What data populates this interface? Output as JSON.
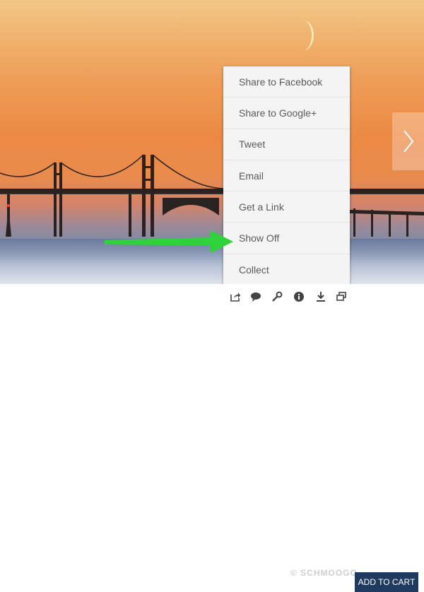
{
  "share_menu": {
    "items": [
      {
        "label": "Share to Facebook"
      },
      {
        "label": "Share to Google+"
      },
      {
        "label": "Tweet"
      },
      {
        "label": "Email"
      },
      {
        "label": "Get a Link"
      },
      {
        "label": "Show Off"
      },
      {
        "label": "Collect"
      }
    ]
  },
  "toolbar": {
    "icons": [
      "share-icon",
      "comment-icon",
      "wrench-icon",
      "info-icon",
      "download-icon",
      "slideshow-icon"
    ],
    "watermark": "© SCHMOOGO",
    "add_to_cart_label": "ADD TO CART"
  },
  "annotation": {
    "arrow_color": "#2fd23a"
  },
  "colors": {
    "cart_button": "#1e3a5f"
  }
}
